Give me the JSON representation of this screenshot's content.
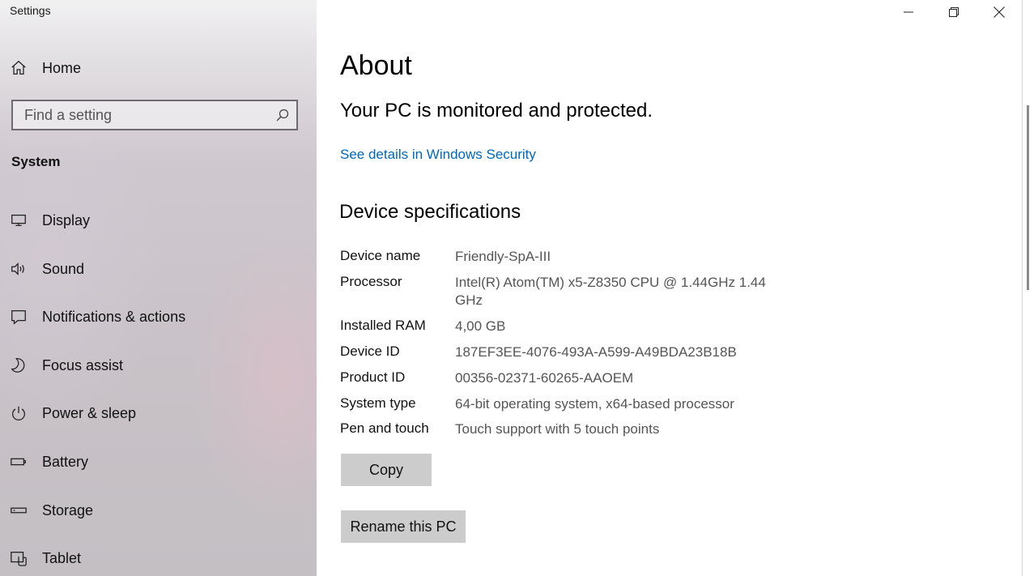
{
  "window": {
    "title": "Settings",
    "controls": {
      "minimize_icon": "minimize-icon",
      "restore_icon": "restore-icon",
      "close_icon": "close-icon"
    }
  },
  "sidebar": {
    "home": {
      "label": "Home",
      "icon": "home-icon"
    },
    "search": {
      "placeholder": "Find a setting",
      "value": "",
      "icon": "search-icon"
    },
    "section_header": "System",
    "items": [
      {
        "label": "Display",
        "icon": "monitor-icon"
      },
      {
        "label": "Sound",
        "icon": "speaker-icon"
      },
      {
        "label": "Notifications & actions",
        "icon": "message-icon"
      },
      {
        "label": "Focus assist",
        "icon": "moon-icon"
      },
      {
        "label": "Power & sleep",
        "icon": "power-icon"
      },
      {
        "label": "Battery",
        "icon": "battery-icon"
      },
      {
        "label": "Storage",
        "icon": "storage-icon"
      },
      {
        "label": "Tablet",
        "icon": "tablet-icon"
      }
    ]
  },
  "main": {
    "title": "About",
    "status": "Your PC is monitored and protected.",
    "security_link": "See details in Windows Security",
    "device_section_title": "Device specifications",
    "specs": [
      {
        "label": "Device name",
        "value": "Friendly-SpA-III"
      },
      {
        "label": "Processor",
        "value": "Intel(R) Atom(TM) x5-Z8350  CPU @ 1.44GHz   1.44 GHz"
      },
      {
        "label": "Installed RAM",
        "value": "4,00 GB"
      },
      {
        "label": "Device ID",
        "value": "187EF3EE-4076-493A-A599-A49BDA23B18B"
      },
      {
        "label": "Product ID",
        "value": "00356-02371-60265-AAOEM"
      },
      {
        "label": "System type",
        "value": "64-bit operating system, x64-based processor"
      },
      {
        "label": "Pen and touch",
        "value": "Touch support with 5 touch points"
      }
    ],
    "copy_button": "Copy",
    "rename_button": "Rename this PC"
  },
  "colors": {
    "accent_link": "#0067c0",
    "button_bg": "#cccccc"
  }
}
